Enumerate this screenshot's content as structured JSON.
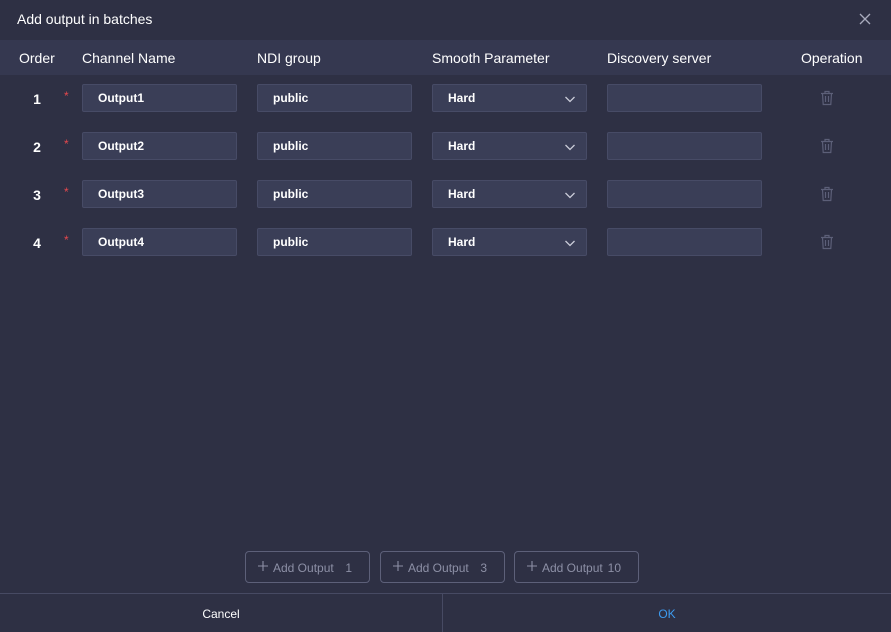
{
  "dialog": {
    "title": "Add output in batches"
  },
  "columns": {
    "order": "Order",
    "channel_name": "Channel Name",
    "ndi_group": "NDI group",
    "smooth_parameter": "Smooth Parameter",
    "discovery_server": "Discovery server",
    "operation": "Operation"
  },
  "required_mark": "*",
  "rows": [
    {
      "order": "1",
      "channel_name": "Output1",
      "ndi_group": "public",
      "smooth": "Hard",
      "discovery": ""
    },
    {
      "order": "2",
      "channel_name": "Output2",
      "ndi_group": "public",
      "smooth": "Hard",
      "discovery": ""
    },
    {
      "order": "3",
      "channel_name": "Output3",
      "ndi_group": "public",
      "smooth": "Hard",
      "discovery": ""
    },
    {
      "order": "4",
      "channel_name": "Output4",
      "ndi_group": "public",
      "smooth": "Hard",
      "discovery": ""
    }
  ],
  "add_buttons": [
    {
      "label": "Add Output",
      "count": "1"
    },
    {
      "label": "Add Output",
      "count": "3"
    },
    {
      "label": "Add Output",
      "count": "10"
    }
  ],
  "footer": {
    "cancel": "Cancel",
    "ok": "OK"
  },
  "icons": {
    "close": "close-icon",
    "chevron": "chevron-down-icon",
    "delete": "trash-icon",
    "add": "plus-icon"
  },
  "colors": {
    "background": "#2e3044",
    "header": "#353850",
    "input": "#3a3e57",
    "accent": "#3d9bf0",
    "required": "#e5484d"
  }
}
